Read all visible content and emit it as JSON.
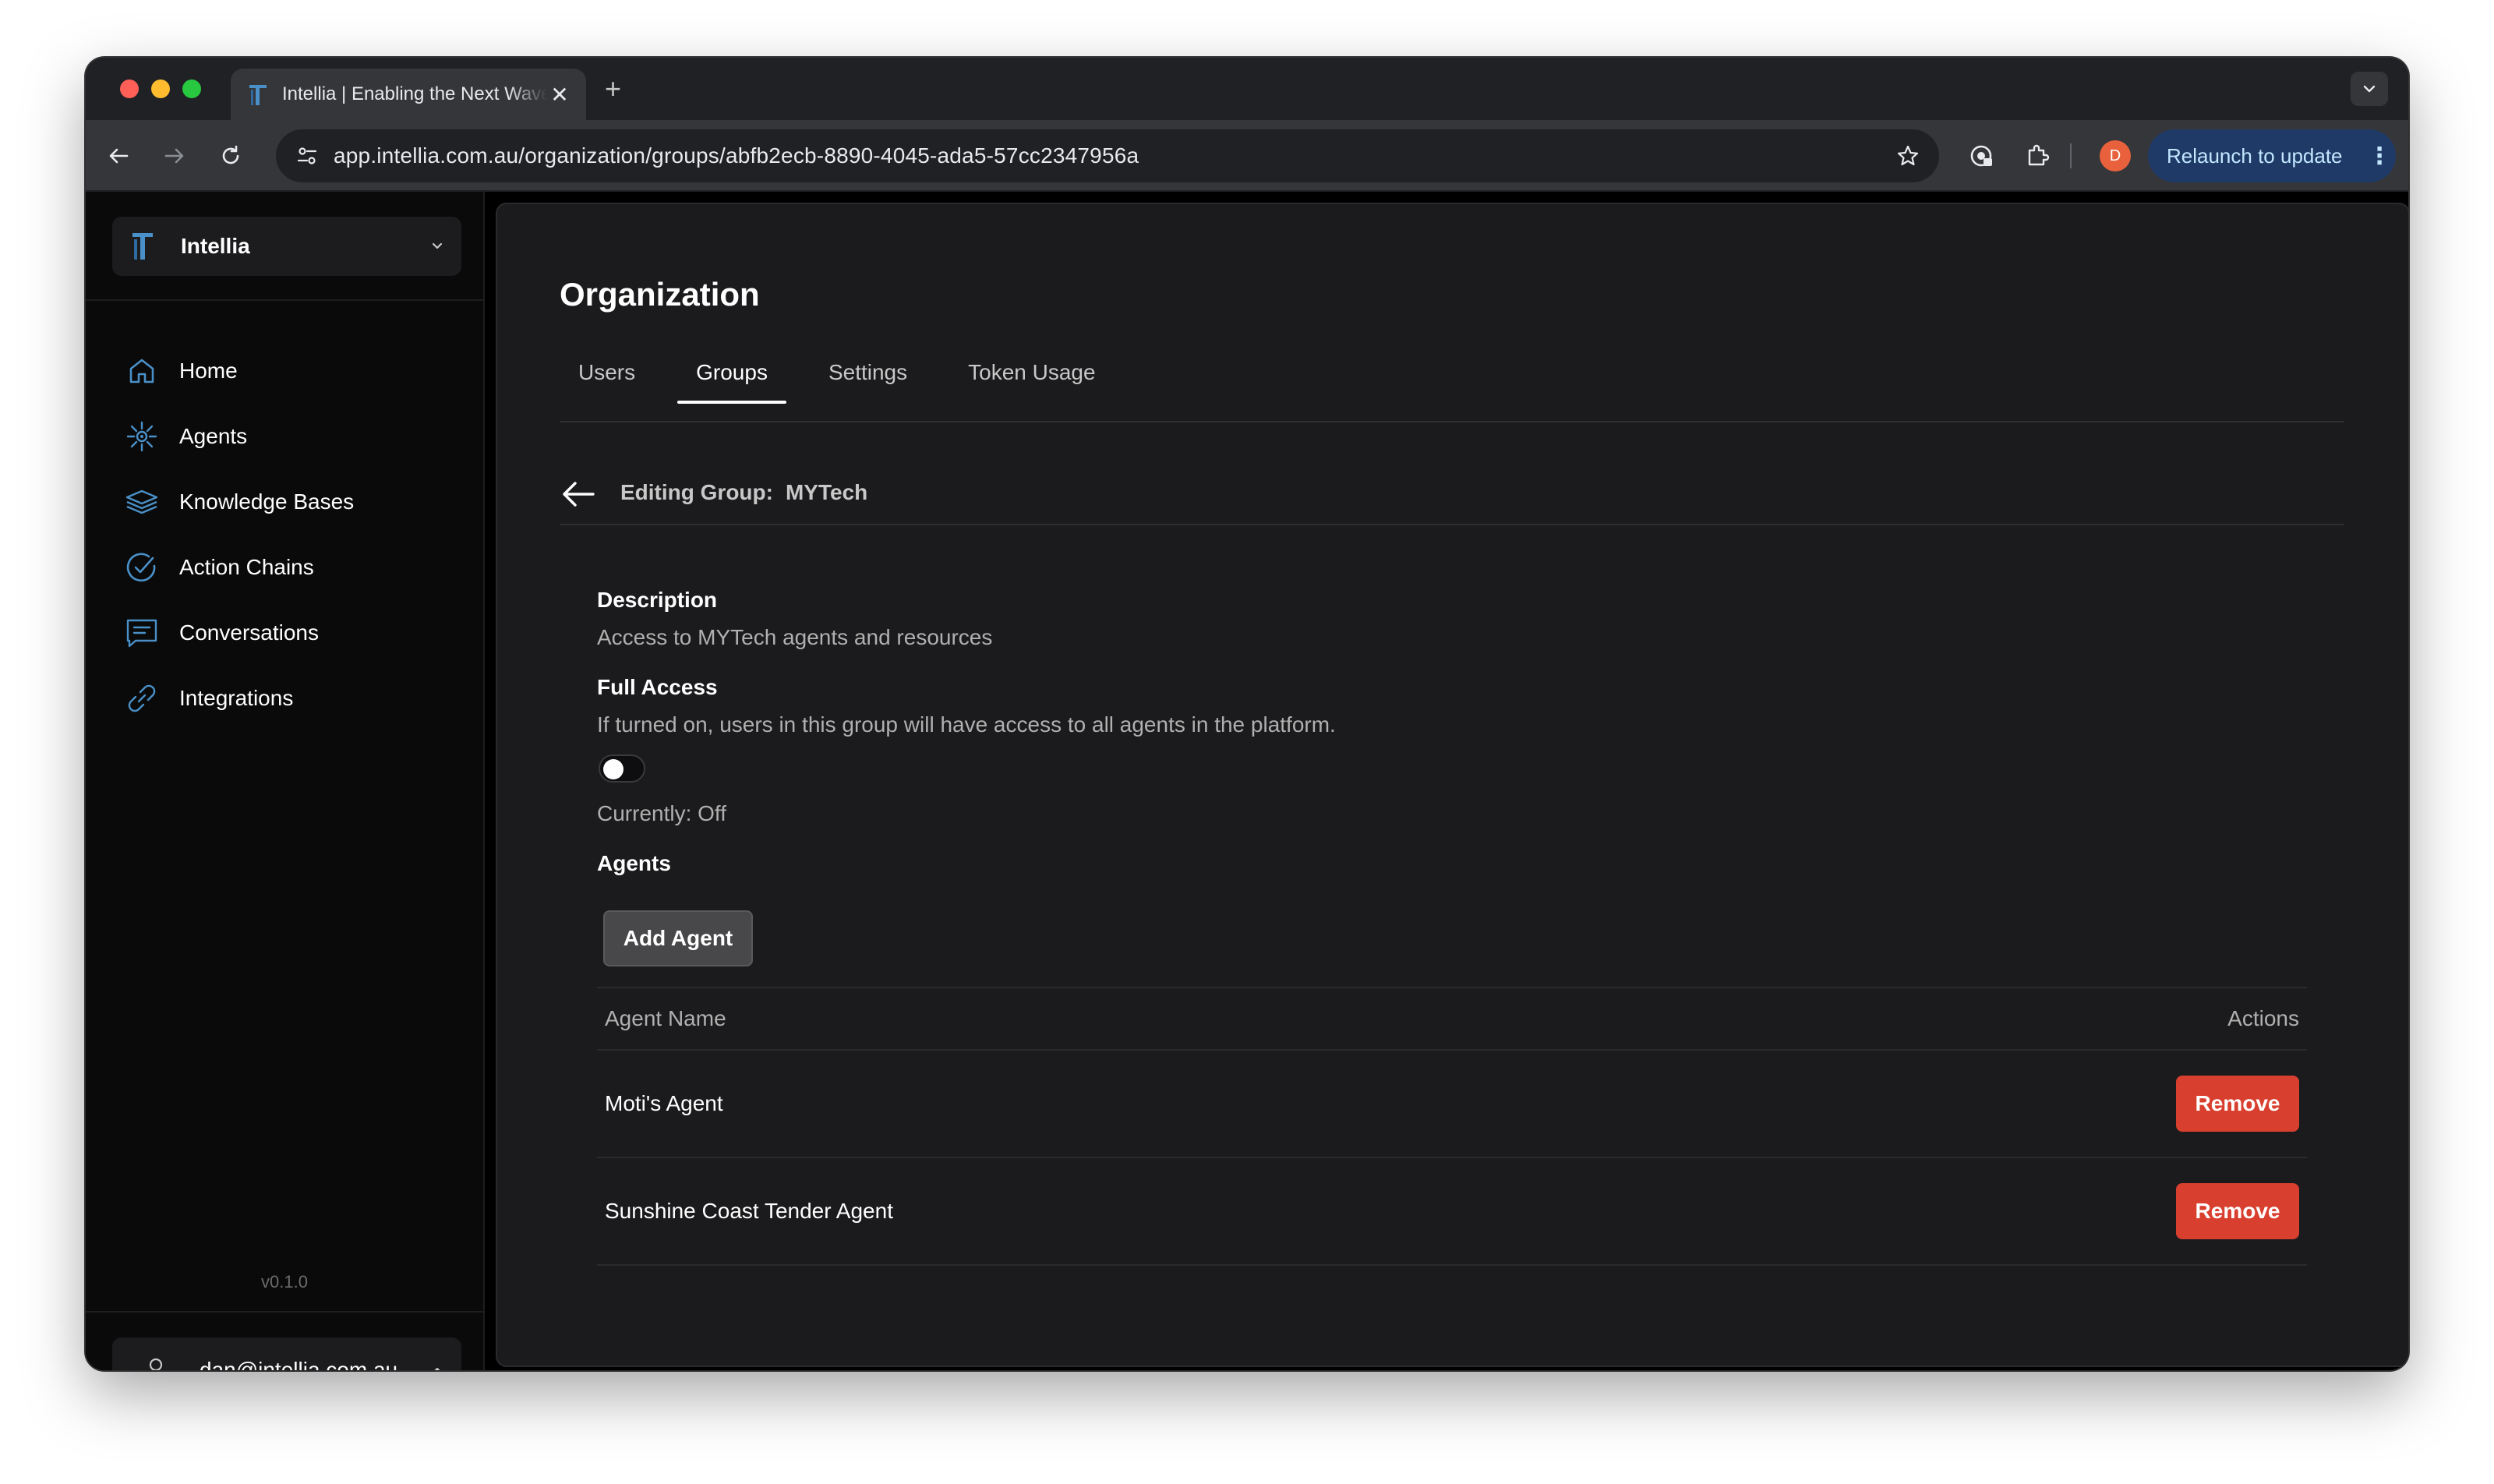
{
  "browser": {
    "tab_title": "Intellia | Enabling the Next Wave of Work",
    "url": "app.intellia.com.au/organization/groups/abfb2ecb-8890-4045-ada5-57cc2347956a",
    "profile_initial": "D",
    "relaunch_label": "Relaunch to update",
    "new_tab_glyph": "+",
    "close_glyph": "✕"
  },
  "sidebar": {
    "org_name": "Intellia",
    "items": [
      {
        "label": "Home",
        "icon": "home-icon"
      },
      {
        "label": "Agents",
        "icon": "agents-icon"
      },
      {
        "label": "Knowledge Bases",
        "icon": "knowledge-bases-icon"
      },
      {
        "label": "Action Chains",
        "icon": "action-chains-icon"
      },
      {
        "label": "Conversations",
        "icon": "conversations-icon"
      },
      {
        "label": "Integrations",
        "icon": "integrations-icon"
      }
    ],
    "version": "v0.1.0",
    "user_email": "dan@intellia.com.au"
  },
  "main": {
    "page_title": "Organization",
    "tabs": [
      {
        "label": "Users",
        "active": false
      },
      {
        "label": "Groups",
        "active": true
      },
      {
        "label": "Settings",
        "active": false
      },
      {
        "label": "Token Usage",
        "active": false
      }
    ],
    "editing_prefix": "Editing Group:",
    "group_name": "MYTech",
    "description_heading": "Description",
    "description_text": "Access to MYTech agents and resources",
    "full_access_heading": "Full Access",
    "full_access_text": "If turned on, users in this group will have access to all agents in the platform.",
    "full_access_on": false,
    "full_access_status": "Currently: Off",
    "agents_heading": "Agents",
    "add_agent_label": "Add Agent",
    "table": {
      "columns": [
        "Agent Name",
        "Actions"
      ],
      "rows": [
        {
          "name": "Moti's Agent",
          "action": "Remove"
        },
        {
          "name": "Sunshine Coast Tender Agent",
          "action": "Remove"
        }
      ]
    }
  },
  "colors": {
    "accent_blue": "#4a90c8",
    "remove_red": "#d93f2f",
    "background": "#1b1b1d"
  }
}
